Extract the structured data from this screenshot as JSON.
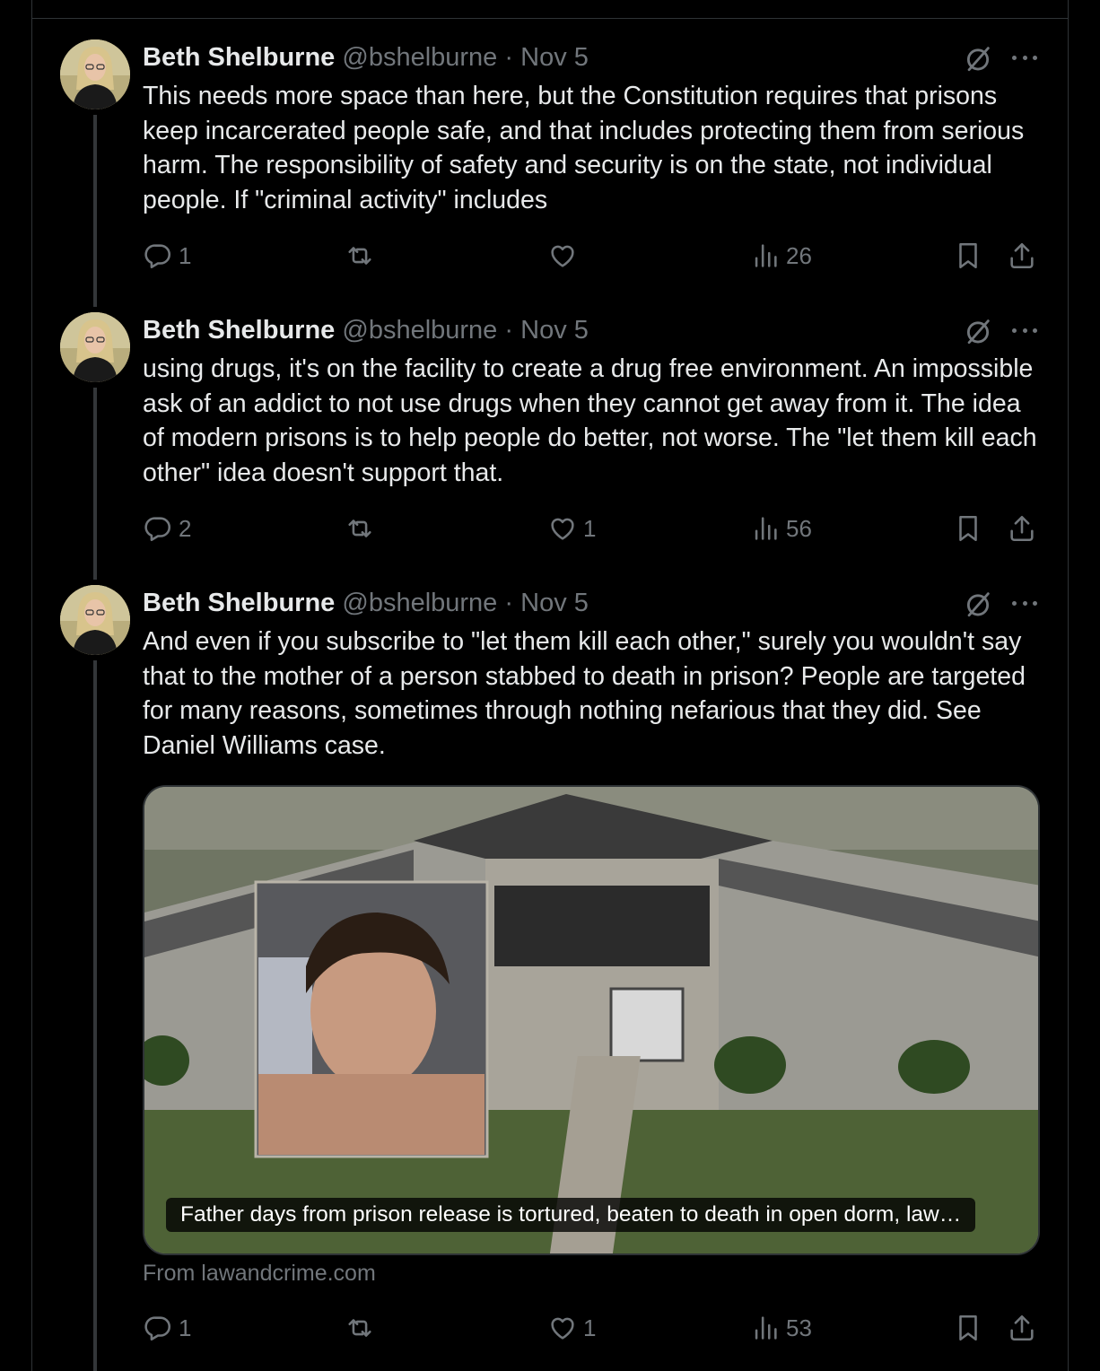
{
  "tweets": [
    {
      "author": "Beth Shelburne",
      "handle": "@bshelburne",
      "date": "Nov 5",
      "text": "This needs more space than here, but the Constitution requires that prisons keep incarcerated people safe, and that includes protecting them from serious harm. The responsibility of safety and security is on the state, not individual people. If \"criminal activity\" includes",
      "replies": "1",
      "reposts": "",
      "likes": "",
      "views": "26"
    },
    {
      "author": "Beth Shelburne",
      "handle": "@bshelburne",
      "date": "Nov 5",
      "text": "using drugs, it's on the facility to create a drug free environment. An impossible ask of an addict to not use drugs when they cannot get away from it. The idea of modern prisons is to help people do better, not worse. The \"let them kill each other\" idea doesn't support that.",
      "replies": "2",
      "reposts": "",
      "likes": "1",
      "views": "56"
    },
    {
      "author": "Beth Shelburne",
      "handle": "@bshelburne",
      "date": "Nov 5",
      "text": "And even if you subscribe to \"let them kill each other,\" surely you wouldn't say that to the mother of a person stabbed to death in prison? People are targeted for many reasons, sometimes through nothing nefarious that they did. See Daniel Williams case.",
      "replies": "1",
      "reposts": "",
      "likes": "1",
      "views": "53",
      "card": {
        "caption": "Father days from prison release is tortured, beaten to death in open dorm, law…",
        "source": "From lawandcrime.com"
      }
    }
  ],
  "separator": "·",
  "icons": [
    "grok-icon",
    "more-icon",
    "reply-icon",
    "repost-icon",
    "like-icon",
    "views-icon",
    "bookmark-icon",
    "share-icon"
  ],
  "colors": {
    "background": "#000000",
    "text": "#e7e9ea",
    "muted": "#71767b",
    "border": "#2f3336"
  }
}
